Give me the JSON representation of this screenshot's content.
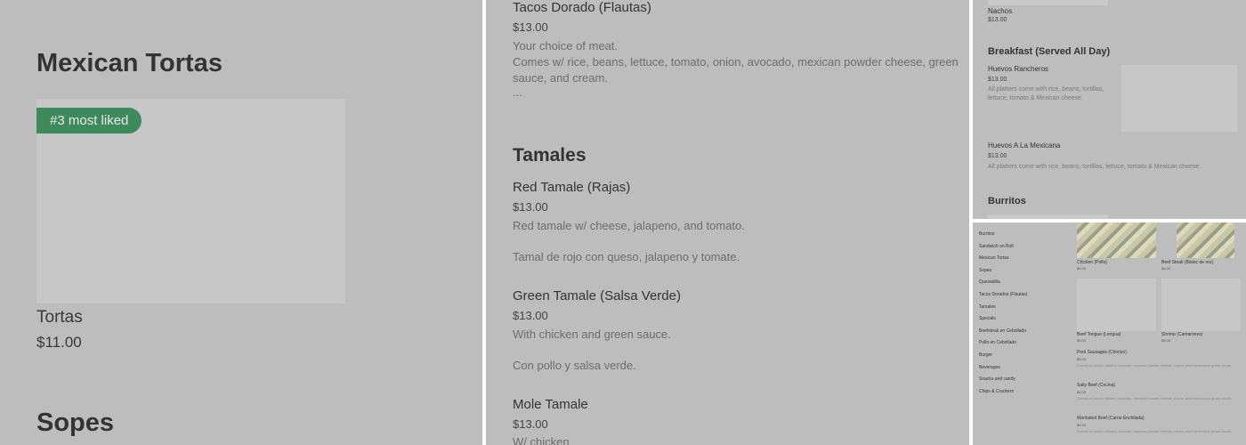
{
  "panel1": {
    "section_title": "Mexican Tortas",
    "badge": "#3 most liked",
    "item_name": "Tortas",
    "item_price": "$11.00",
    "next_section": "Sopes"
  },
  "panel2": {
    "flautas_name": "Tacos Dorado (Flautas)",
    "flautas_price": "$13.00",
    "flautas_desc1": "Your choice of meat.",
    "flautas_desc2": "Comes w/ rice, beans, lettuce, tomato, onion, avocado, mexican powder cheese, green",
    "flautas_desc3": "sauce, and cream.",
    "flautas_more": "...",
    "tamales_title": "Tamales",
    "red_name": "Red Tamale (Rajas)",
    "red_price": "$13.00",
    "red_desc1": "Red tamale w/ cheese, jalapeno, and tomato.",
    "red_desc2": "Tamal de rojo con queso, jalapeno y tomate.",
    "green_name": "Green Tamale (Salsa Verde)",
    "green_price": "$13.00",
    "green_desc1": "With chicken and green sauce.",
    "green_desc2": "Con pollo y salsa verde.",
    "mole_name": "Mole Tamale",
    "mole_price": "$13.00",
    "mole_desc": "W/ chicken"
  },
  "panel3": {
    "nachos_name": "Nachos",
    "nachos_price": "$13.00",
    "breakfast_title": "Breakfast (Served All Day)",
    "rancheros_name": "Huevos Rancheros",
    "rancheros_price": "$13.00",
    "rancheros_desc1": "All platters come with rice, beans, tortillas,",
    "rancheros_desc2": "lettuce, tomato & Mexican cheese.",
    "mexicana_name": "Huevos A La Mexicana",
    "mexicana_price": "$13.00",
    "mexicana_desc": "All platters come with rice, beans, tortillas, lettuce, tomato & Mexican cheese.",
    "burritos_title": "Burritos"
  },
  "panel4": {
    "categories": [
      "Burritos",
      "Sandwich on Roll",
      "Mexican Tortas",
      "Sopes",
      "Quesadilla",
      "Tacos Dorados (Flautas)",
      "Tamales",
      "Specials",
      "Beefsteak en Cebollado",
      "Pollo en Cebollado",
      "Burger",
      "Beverages",
      "Snacks and candy",
      "Chips & Crackers"
    ],
    "tile1_name": "Chicken (Pollo)",
    "tile1_price": "$4.00",
    "tile2_name": "Beef Steak (Bistec de res)",
    "tile2_price": "$4.00",
    "tile3_name": "Beef Tongue (Lengua)",
    "tile3_price": "$5.00",
    "tile4_name": "Shrimp (Camarones)",
    "tile4_price": "$5.00",
    "list1_name": "Pork Sausages (Chorizo)",
    "list1_price": "$4.00",
    "list1_desc": "Comes w/ onion, cilantro, avocado, mexican powder cheese, cream, and homemade green sauce.",
    "list2_name": "Salty Beef (Cecina)",
    "list2_price": "$4.00",
    "list2_desc": "Comes w/ onion, cilantro, avocado, mexican powder cheese, cream, and homemade green sauce.",
    "list3_name": "Marinated Beef (Carne Enchilada)",
    "list3_price": "$4.00",
    "list3_desc": "Comes w/ onion, cilantro, avocado, mexican powder cheese, cream, and homemade green sauce."
  }
}
